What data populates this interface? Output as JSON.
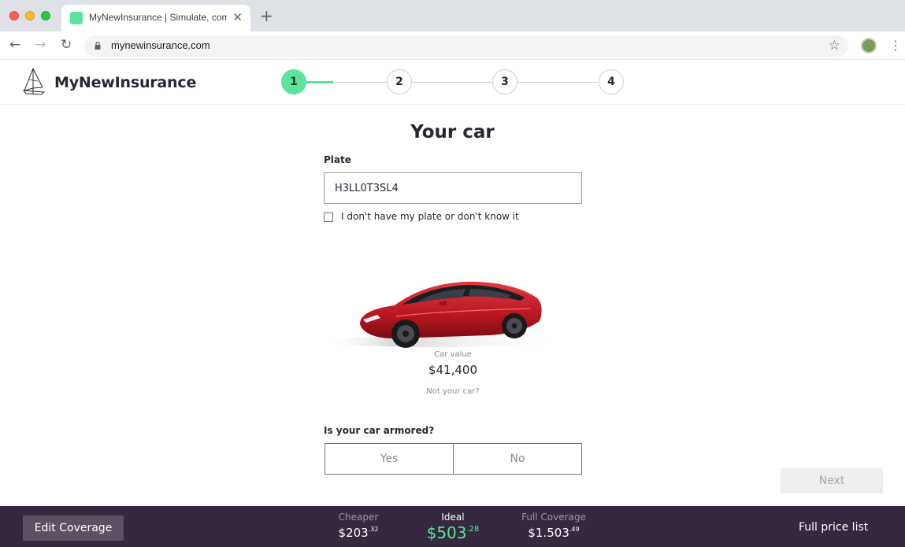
{
  "browser": {
    "tab_title": "MyNewInsurance | Simulate, compare and save",
    "tab_close": "✕",
    "new_tab": "+",
    "url": "mynewinsurance.com"
  },
  "header": {
    "brand": "MyNewInsurance",
    "steps": [
      "1",
      "2",
      "3",
      "4"
    ],
    "active_step": 1,
    "step_progress": 0.33
  },
  "main": {
    "title": "Your car",
    "plate_label": "Plate",
    "plate_value": "H3LL0T3SL4",
    "no_plate_label": "I don't have my plate or don't know it",
    "car_value_label": "Car value",
    "car_value": "$41,400",
    "not_your_car": "Not your car?",
    "armored_label": "Is your car armored?",
    "armored_yes": "Yes",
    "armored_no": "No",
    "next": "Next"
  },
  "footer": {
    "edit_coverage": "Edit Coverage",
    "plans": [
      {
        "name": "Cheaper",
        "amount": "$203",
        "cents": ".32"
      },
      {
        "name": "Ideal",
        "amount": "$503",
        "cents": ".28"
      },
      {
        "name": "Full Coverage",
        "amount": "$1.503",
        "cents": ".49"
      }
    ],
    "full_price_list": "Full price list"
  },
  "colors": {
    "accent": "#5be49c",
    "footer_bg": "#35283f",
    "car_red": "#c8202a"
  }
}
